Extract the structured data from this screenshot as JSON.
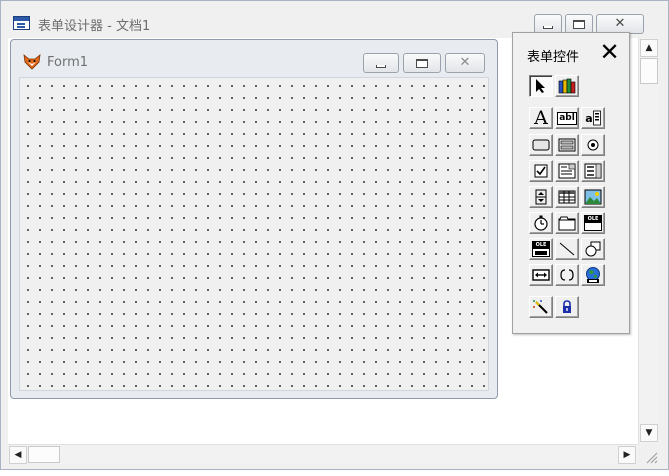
{
  "app": {
    "title": "表单设计器 - 文档1"
  },
  "form": {
    "title": "Form1"
  },
  "toolbox": {
    "title": "表单控件",
    "close_glyph": "✕",
    "tools": [
      {
        "name": "pointer-tool",
        "icon": "arrow-pointer-icon"
      },
      {
        "name": "view-classes-tool",
        "icon": "books-icon"
      },
      {
        "name": "label-tool",
        "icon": "letter-a-icon",
        "glyph": "A"
      },
      {
        "name": "textbox-tool",
        "icon": "textbox-icon",
        "glyph": "abl"
      },
      {
        "name": "editbox-tool",
        "icon": "editbox-icon",
        "glyph": "a"
      },
      {
        "name": "command-button-tool",
        "icon": "button-icon"
      },
      {
        "name": "command-group-tool",
        "icon": "button-group-icon"
      },
      {
        "name": "option-group-tool",
        "icon": "radio-icon"
      },
      {
        "name": "check-box-tool",
        "icon": "checkbox-icon"
      },
      {
        "name": "combo-box-tool",
        "icon": "combo-box-icon"
      },
      {
        "name": "list-box-tool",
        "icon": "list-box-icon"
      },
      {
        "name": "spinner-tool",
        "icon": "spinner-icon"
      },
      {
        "name": "grid-tool",
        "icon": "grid-icon"
      },
      {
        "name": "image-tool",
        "icon": "image-icon"
      },
      {
        "name": "timer-tool",
        "icon": "stopwatch-icon"
      },
      {
        "name": "page-frame-tool",
        "icon": "page-frame-icon"
      },
      {
        "name": "activex-control-tool",
        "icon": "ole-container-icon",
        "glyph": "OLE"
      },
      {
        "name": "activex-bound-control-tool",
        "icon": "ole-bound-icon",
        "glyph": "OLE"
      },
      {
        "name": "line-tool",
        "icon": "line-icon"
      },
      {
        "name": "shape-tool",
        "icon": "shapes-icon"
      },
      {
        "name": "container-tool",
        "icon": "container-icon"
      },
      {
        "name": "separator-tool",
        "icon": "separator-icon"
      },
      {
        "name": "hyperlink-tool",
        "icon": "globe-icon"
      },
      {
        "name": "builder-lock-tool",
        "icon": "magic-wand-icon"
      },
      {
        "name": "button-lock-tool",
        "icon": "padlock-icon"
      }
    ]
  },
  "colors": {
    "canvas": "#f0f0f0",
    "grid_dot": "#3c3c3c",
    "title_text": "#6e6e6e"
  }
}
